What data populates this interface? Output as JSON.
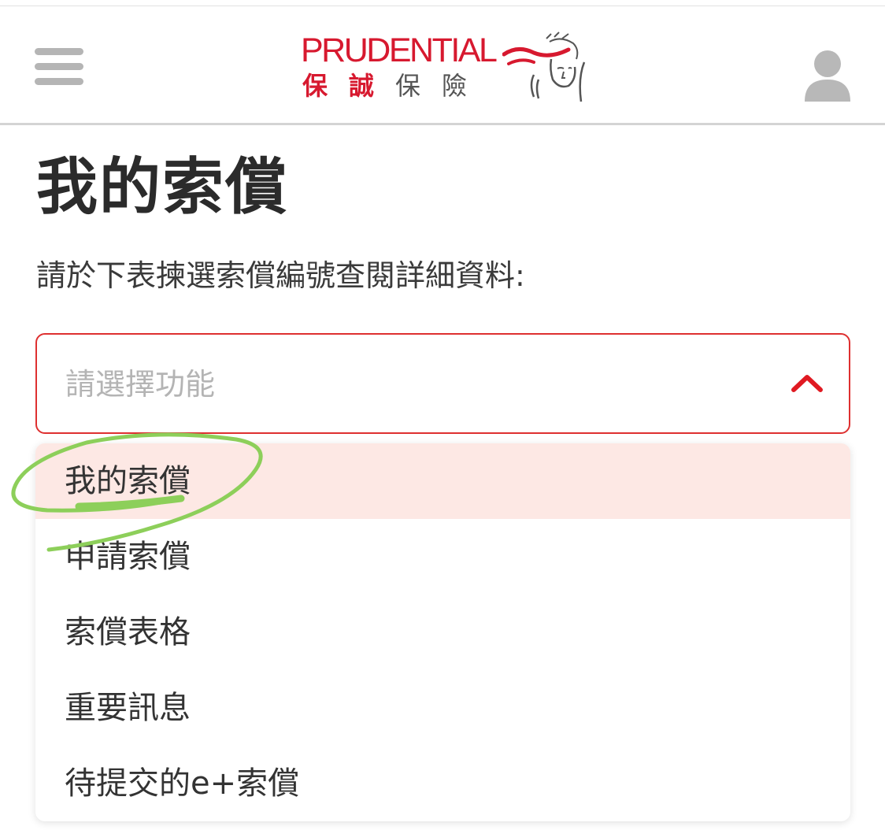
{
  "header": {
    "logo_en": "PRUDENTIAL",
    "logo_zh_brand": "保誠",
    "logo_zh_suffix": "保險",
    "menu_icon": "hamburger-menu-icon",
    "user_icon": "user-profile-icon"
  },
  "page": {
    "title": "我的索償",
    "instruction": "請於下表揀選索償編號查閱詳細資料:"
  },
  "select": {
    "placeholder": "請選擇功能",
    "expanded": true,
    "chevron_icon": "chevron-up-icon",
    "options": [
      {
        "label": "我的索償",
        "selected": true
      },
      {
        "label": "申請索償",
        "selected": false
      },
      {
        "label": "索償表格",
        "selected": false
      },
      {
        "label": "重要訊息",
        "selected": false
      },
      {
        "label": "待提交的e+索償",
        "selected": false
      }
    ]
  },
  "colors": {
    "brand_red": "#d7192f",
    "border_red": "#de3030",
    "selected_bg": "#fde8e4",
    "annotation_green": "#8dcf5a"
  }
}
